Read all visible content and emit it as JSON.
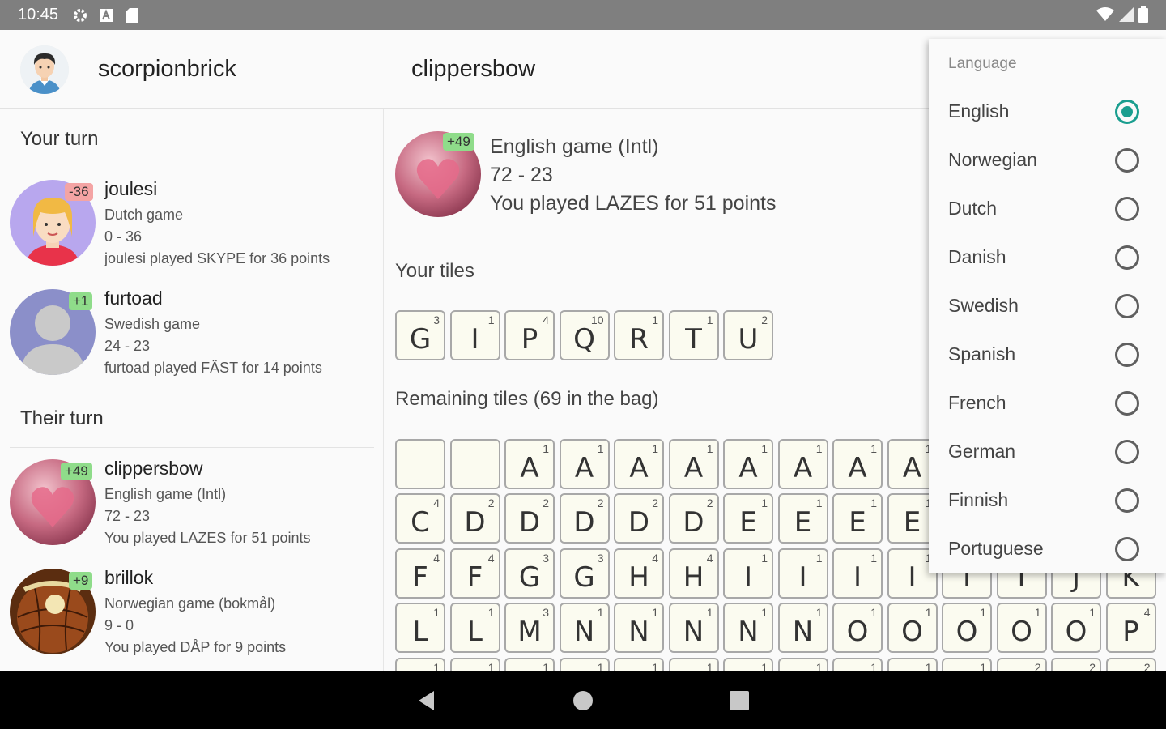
{
  "status_bar": {
    "time": "10:45"
  },
  "header": {
    "user_name": "scorpionbrick",
    "opponent_name": "clippersbow"
  },
  "games": {
    "your_turn_label": "Your turn",
    "their_turn_label": "Their turn",
    "your_turn": [
      {
        "badge": "-36",
        "badge_type": "neg",
        "name": "joulesi",
        "language": "Dutch game",
        "score": "0 - 36",
        "last_move": "joulesi played SKYPE for 36 points"
      },
      {
        "badge": "+1",
        "badge_type": "pos",
        "name": "furtoad",
        "language": "Swedish game",
        "score": "24 - 23",
        "last_move": "furtoad played FÄST for 14 points"
      }
    ],
    "their_turn": [
      {
        "badge": "+49",
        "badge_type": "pos",
        "name": "clippersbow",
        "language": "English game (Intl)",
        "score": "72 - 23",
        "last_move": "You played LAZES for 51 points"
      },
      {
        "badge": "+9",
        "badge_type": "pos",
        "name": "brillok",
        "language": "Norwegian game (bokmål)",
        "score": "9 - 0",
        "last_move": "You played DÅP for 9 points"
      }
    ]
  },
  "game_detail": {
    "badge": "+49",
    "title": "English game (Intl)",
    "score": "72 - 23",
    "last_move": "You played LAZES for 51 points",
    "your_tiles_label": "Your tiles",
    "remaining_label": "Remaining tiles (69 in the bag)"
  },
  "your_tiles": [
    {
      "letter": "G",
      "score": "3"
    },
    {
      "letter": "I",
      "score": "1"
    },
    {
      "letter": "P",
      "score": "4"
    },
    {
      "letter": "Q",
      "score": "10"
    },
    {
      "letter": "R",
      "score": "1"
    },
    {
      "letter": "T",
      "score": "1"
    },
    {
      "letter": "U",
      "score": "2"
    }
  ],
  "remaining_tiles": [
    [
      {
        "letter": "",
        "score": ""
      },
      {
        "letter": "",
        "score": ""
      },
      {
        "letter": "A",
        "score": "1"
      },
      {
        "letter": "A",
        "score": "1"
      },
      {
        "letter": "A",
        "score": "1"
      },
      {
        "letter": "A",
        "score": "1"
      },
      {
        "letter": "A",
        "score": "1"
      },
      {
        "letter": "A",
        "score": "1"
      },
      {
        "letter": "A",
        "score": "1"
      },
      {
        "letter": "A",
        "score": "1"
      }
    ],
    [
      {
        "letter": "C",
        "score": "4"
      },
      {
        "letter": "D",
        "score": "2"
      },
      {
        "letter": "D",
        "score": "2"
      },
      {
        "letter": "D",
        "score": "2"
      },
      {
        "letter": "D",
        "score": "2"
      },
      {
        "letter": "D",
        "score": "2"
      },
      {
        "letter": "E",
        "score": "1"
      },
      {
        "letter": "E",
        "score": "1"
      },
      {
        "letter": "E",
        "score": "1"
      },
      {
        "letter": "E",
        "score": "1"
      }
    ],
    [
      {
        "letter": "F",
        "score": "4"
      },
      {
        "letter": "F",
        "score": "4"
      },
      {
        "letter": "G",
        "score": "3"
      },
      {
        "letter": "G",
        "score": "3"
      },
      {
        "letter": "H",
        "score": "4"
      },
      {
        "letter": "H",
        "score": "4"
      },
      {
        "letter": "I",
        "score": "1"
      },
      {
        "letter": "I",
        "score": "1"
      },
      {
        "letter": "I",
        "score": "1"
      },
      {
        "letter": "I",
        "score": "1"
      },
      {
        "letter": "I",
        "score": "1"
      },
      {
        "letter": "I",
        "score": "1"
      },
      {
        "letter": "J",
        "score": "8"
      },
      {
        "letter": "K",
        "score": "5"
      }
    ],
    [
      {
        "letter": "L",
        "score": "1"
      },
      {
        "letter": "L",
        "score": "1"
      },
      {
        "letter": "M",
        "score": "3"
      },
      {
        "letter": "N",
        "score": "1"
      },
      {
        "letter": "N",
        "score": "1"
      },
      {
        "letter": "N",
        "score": "1"
      },
      {
        "letter": "N",
        "score": "1"
      },
      {
        "letter": "N",
        "score": "1"
      },
      {
        "letter": "O",
        "score": "1"
      },
      {
        "letter": "O",
        "score": "1"
      },
      {
        "letter": "O",
        "score": "1"
      },
      {
        "letter": "O",
        "score": "1"
      },
      {
        "letter": "O",
        "score": "1"
      },
      {
        "letter": "P",
        "score": "4"
      }
    ],
    [
      {
        "letter": "",
        "score": "1"
      },
      {
        "letter": "",
        "score": "1"
      },
      {
        "letter": "",
        "score": "1"
      },
      {
        "letter": "",
        "score": "1"
      },
      {
        "letter": "",
        "score": "1"
      },
      {
        "letter": "",
        "score": "1"
      },
      {
        "letter": "",
        "score": "1"
      },
      {
        "letter": "",
        "score": "1"
      },
      {
        "letter": "",
        "score": "1"
      },
      {
        "letter": "",
        "score": "1"
      },
      {
        "letter": "",
        "score": "1"
      },
      {
        "letter": "",
        "score": "2"
      },
      {
        "letter": "",
        "score": "2"
      },
      {
        "letter": "",
        "score": "2"
      }
    ]
  ],
  "language_menu": {
    "title": "Language",
    "options": [
      {
        "label": "English",
        "selected": true
      },
      {
        "label": "Norwegian",
        "selected": false
      },
      {
        "label": "Dutch",
        "selected": false
      },
      {
        "label": "Danish",
        "selected": false
      },
      {
        "label": "Swedish",
        "selected": false
      },
      {
        "label": "Spanish",
        "selected": false
      },
      {
        "label": "French",
        "selected": false
      },
      {
        "label": "German",
        "selected": false
      },
      {
        "label": "Finnish",
        "selected": false
      },
      {
        "label": "Portuguese",
        "selected": false
      }
    ]
  },
  "colors": {
    "accent": "#1a9e8f",
    "badge_positive": "#8fdc8a",
    "badge_negative": "#f4a4a4",
    "tile_bg": "#fbfbf0"
  },
  "icons": [
    "gear-icon",
    "a-icon",
    "sd-card-icon",
    "wifi-icon",
    "signal-icon",
    "battery-icon",
    "back-icon",
    "home-icon",
    "recents-icon"
  ]
}
